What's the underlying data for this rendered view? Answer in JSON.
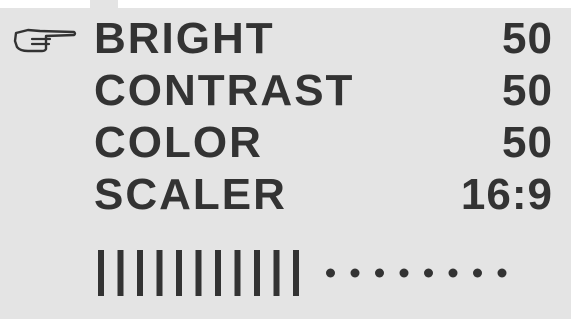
{
  "menu": {
    "items": [
      {
        "label": "BRIGHT",
        "value": "50",
        "selected": true
      },
      {
        "label": "CONTRAST",
        "value": "50",
        "selected": false
      },
      {
        "label": "COLOR",
        "value": "50",
        "selected": false
      },
      {
        "label": "SCALER",
        "value": "16:9",
        "selected": false
      }
    ],
    "selector_icon": "pointing-hand-icon"
  },
  "level_bar": {
    "level": 0.58,
    "filled_segments": 11,
    "empty_segments": 8
  },
  "colors": {
    "panel": "#e4e4e4",
    "text": "#333333",
    "background": "#ffffff"
  }
}
